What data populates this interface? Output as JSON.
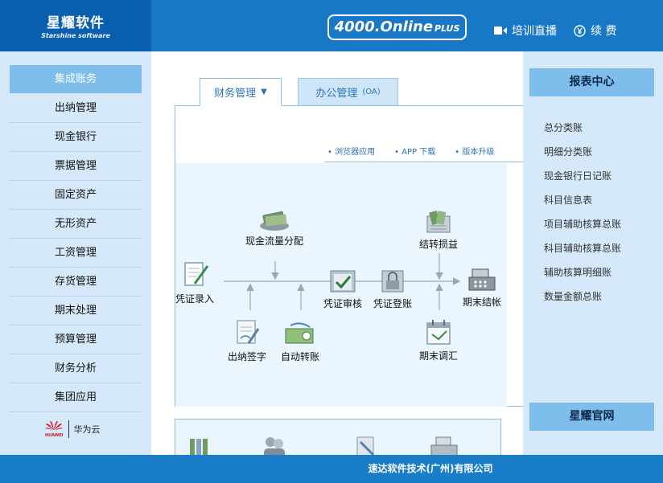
{
  "header": {
    "logo_title": "星耀软件",
    "logo_subtitle": "Starshine software",
    "badge_main": "4000.Online",
    "badge_plus": "PLUS",
    "live_label": "培训直播",
    "renew_label": "续 费",
    "live_icon": "video-camera-icon",
    "renew_icon": "yen-circle-icon"
  },
  "left_sidebar": {
    "header": "集成账务",
    "items": [
      "出纳管理",
      "现金银行",
      "票据管理",
      "固定资产",
      "无形资产",
      "工资管理",
      "存货管理",
      "期末处理",
      "预算管理",
      "财务分析",
      "集团应用"
    ],
    "partner_logo_text": "HUAWEI",
    "partner_label": "华为云"
  },
  "tabs": {
    "finance": "财务管理",
    "finance_arrow": "▼",
    "office": "办公管理",
    "office_suffix": "(OA)"
  },
  "subnav": {
    "browser": "• 浏览器应用",
    "app": "• APP 下载",
    "upgrade": "• 版本升级"
  },
  "flow": {
    "voucher_entry": "凭证录入",
    "cash_flow": "现金流量分配",
    "cashier_sign": "出纳签字",
    "auto_transfer": "自动转账",
    "voucher_audit": "凭证审核",
    "voucher_post": "凭证登账",
    "carry_profit": "结转损益",
    "period_adjust": "期末调汇",
    "period_close": "期末结帐"
  },
  "right_sidebar": {
    "header": "报表中心",
    "items": [
      "总分类账",
      "明细分类账",
      "现金银行日记账",
      "科目信息表",
      "项目辅助核算总账",
      "科目辅助核算总账",
      "辅助核算明细账",
      "数量金额总账"
    ],
    "official_site": "星耀官网"
  },
  "footer": {
    "company": "速达软件技术(广州)有限公司"
  },
  "colors": {
    "header_blue": "#1878c6",
    "logo_blue": "#0a5fae",
    "sidebar_bg": "#d6e9fa",
    "accent_light": "#7fbdec",
    "flow_bg": "#eaf5fd"
  }
}
